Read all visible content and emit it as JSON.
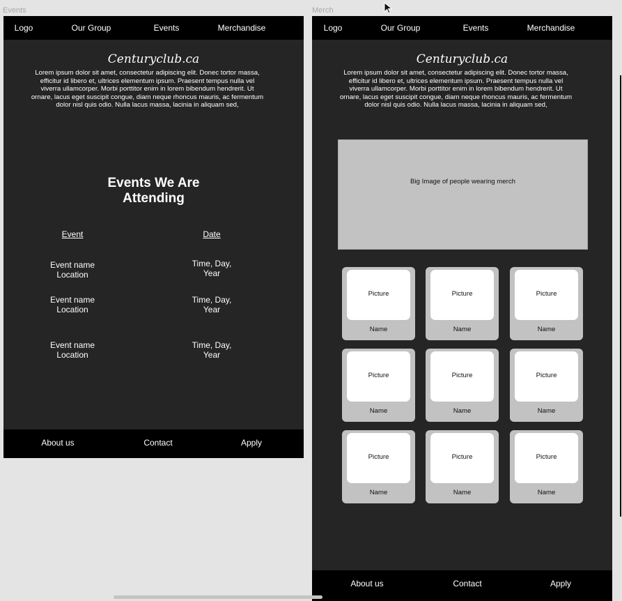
{
  "frames": {
    "events_label": "Events",
    "merch_label": "Merch"
  },
  "nav": {
    "logo": "Logo",
    "group": "Our Group",
    "events": "Events",
    "merch": "Merchandise"
  },
  "site": {
    "title": "Centuryclub.ca",
    "intro": "Lorem ipsum dolor sit amet, consectetur adipiscing elit. Donec tortor massa, efficitur id libero et, ultrices elementum ipsum. Praesent tempus nulla vel viverra ullamcorper. Morbi porttitor enim in lorem bibendum hendrerit. Ut ornare, lacus eget suscipit congue, diam neque rhoncus mauris, ac fermentum dolor nisl quis odio. Nulla lacus massa, lacinia in aliquam sed,"
  },
  "events_page": {
    "heading": "Events We Are Attending",
    "col_event": "Event",
    "col_date": "Date",
    "rows": [
      {
        "event": "Event name Location",
        "date": "Time, Day, Year"
      },
      {
        "event": "Event name Location",
        "date": "Time, Day, Year"
      },
      {
        "event": "Event name Location",
        "date": "Time, Day, Year"
      }
    ]
  },
  "merch_page": {
    "hero_text": "Big Image of people wearing merch",
    "items": [
      {
        "picture": "Picture",
        "name": "Name"
      },
      {
        "picture": "Picture",
        "name": "Name"
      },
      {
        "picture": "Picture",
        "name": "Name"
      },
      {
        "picture": "Picture",
        "name": "Name"
      },
      {
        "picture": "Picture",
        "name": "Name"
      },
      {
        "picture": "Picture",
        "name": "Name"
      },
      {
        "picture": "Picture",
        "name": "Name"
      },
      {
        "picture": "Picture",
        "name": "Name"
      },
      {
        "picture": "Picture",
        "name": "Name"
      }
    ]
  },
  "footer": {
    "about": "About us",
    "contact": "Contact",
    "apply": "Apply"
  }
}
